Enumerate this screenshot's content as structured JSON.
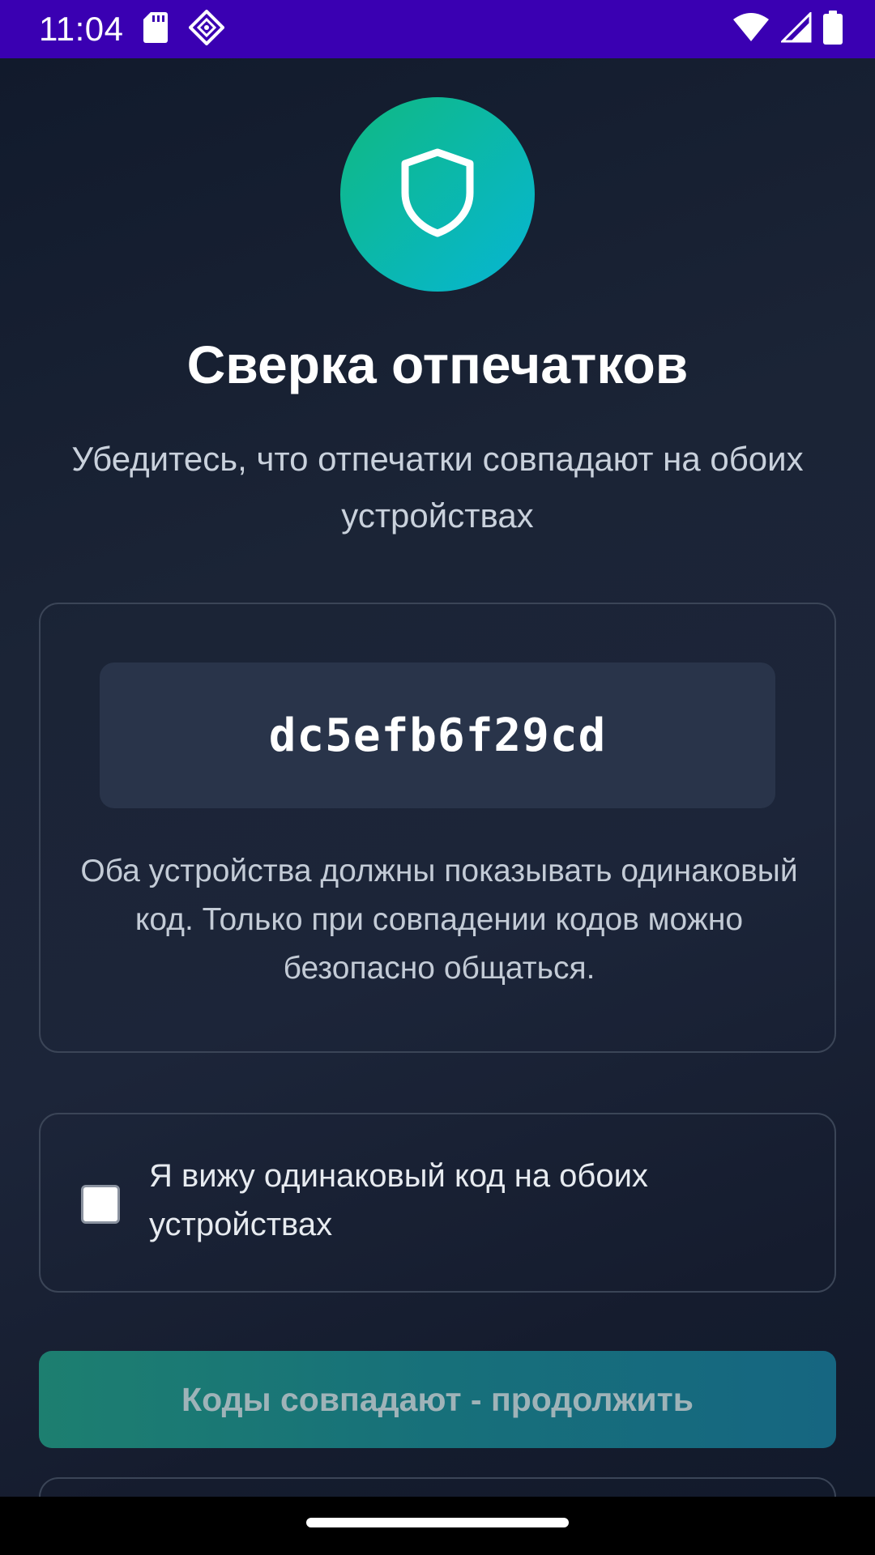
{
  "status_bar": {
    "time": "11:04",
    "left_icons": [
      "sd-card-icon",
      "debug-icon"
    ],
    "right_icons": [
      "wifi-icon",
      "cell-signal-icon",
      "battery-icon"
    ],
    "background": "#3a00b2"
  },
  "header": {
    "icon": "shield-icon",
    "title": "Сверка отпечатков",
    "subtitle": "Убедитесь, что отпечатки совпадают на обоих устройствах"
  },
  "fingerprint": {
    "code": "dc5efb6f29cd",
    "description": "Оба устройства должны показывать одинаковый код. Только при совпадении кодов можно безопасно общаться."
  },
  "confirmation": {
    "checked": false,
    "label": "Я вижу одинаковый код на обоих устройствах"
  },
  "actions": {
    "continue_label": "Коды совпадают - продолжить",
    "continue_enabled": false
  },
  "colors": {
    "accent_start": "#10b981",
    "accent_end": "#06b6d4",
    "background": "#1b2436"
  }
}
